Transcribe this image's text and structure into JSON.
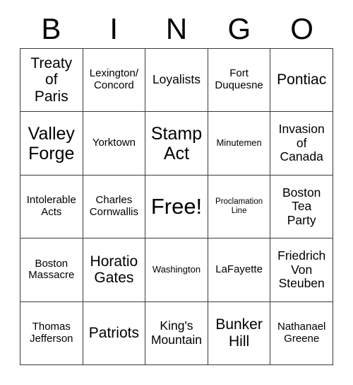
{
  "header": {
    "letters": [
      "B",
      "I",
      "N",
      "G",
      "O"
    ]
  },
  "grid": {
    "rows": 5,
    "columns": 5,
    "border_color": "#3a3a3a",
    "background_color": "#ffffff",
    "text_color": "#000000",
    "cells": [
      {
        "text": "Treaty\nof\nParis",
        "size": "fs-l"
      },
      {
        "text": "Lexington/\nConcord",
        "size": "fs-s"
      },
      {
        "text": "Loyalists",
        "size": "fs-m"
      },
      {
        "text": "Fort\nDuquesne",
        "size": "fs-s"
      },
      {
        "text": "Pontiac",
        "size": "fs-l"
      },
      {
        "text": "Valley\nForge",
        "size": "fs-xl"
      },
      {
        "text": "Yorktown",
        "size": "fs-s"
      },
      {
        "text": "Stamp\nAct",
        "size": "fs-xl"
      },
      {
        "text": "Minutemen",
        "size": "fs-xs"
      },
      {
        "text": "Invasion\nof\nCanada",
        "size": "fs-m"
      },
      {
        "text": "Intolerable\nActs",
        "size": "fs-s"
      },
      {
        "text": "Charles\nCornwallis",
        "size": "fs-s"
      },
      {
        "text": "Free!",
        "size": "fs-xxl"
      },
      {
        "text": "Proclamation\nLine",
        "size": "fs-xxs"
      },
      {
        "text": "Boston\nTea\nParty",
        "size": "fs-m"
      },
      {
        "text": "Boston\nMassacre",
        "size": "fs-s"
      },
      {
        "text": "Horatio\nGates",
        "size": "fs-l"
      },
      {
        "text": "Washington",
        "size": "fs-xs"
      },
      {
        "text": "LaFayette",
        "size": "fs-s"
      },
      {
        "text": "Friedrich\nVon\nSteuben",
        "size": "fs-m"
      },
      {
        "text": "Thomas\nJefferson",
        "size": "fs-s"
      },
      {
        "text": "Patriots",
        "size": "fs-l"
      },
      {
        "text": "King's\nMountain",
        "size": "fs-m"
      },
      {
        "text": "Bunker\nHill",
        "size": "fs-l"
      },
      {
        "text": "Nathanael\nGreene",
        "size": "fs-s"
      }
    ]
  }
}
